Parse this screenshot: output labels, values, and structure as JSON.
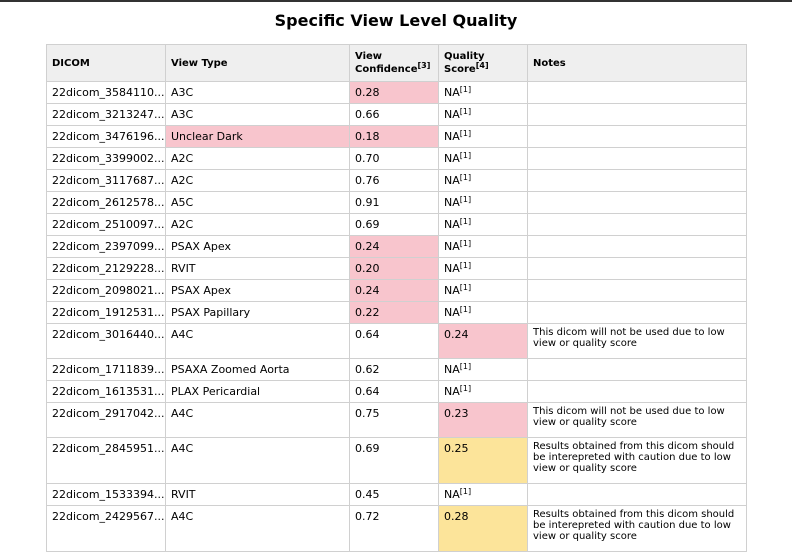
{
  "title": "Specific View Level Quality",
  "colors": {
    "low": "#f8c5cd",
    "caution": "#fce49a",
    "header_bg": "#efefef"
  },
  "columns": {
    "dicom": "DICOM",
    "view_type": "View Type",
    "confidence": "View",
    "confidence_line2": "Confidence",
    "confidence_ref": "[3]",
    "quality": "Quality",
    "quality_line2": "Score",
    "quality_ref": "[4]",
    "notes": "Notes"
  },
  "rows": [
    {
      "dicom": "22dicom_3584110...",
      "view": "A3C",
      "conf": "0.28",
      "score": "NA",
      "score_ref": "[1]",
      "notes": ""
    },
    {
      "dicom": "22dicom_3213247...",
      "view": "A3C",
      "conf": "0.66",
      "score": "NA",
      "score_ref": "[1]",
      "notes": ""
    },
    {
      "dicom": "22dicom_3476196...",
      "view": "Unclear Dark",
      "conf": "0.18",
      "score": "NA",
      "score_ref": "[1]",
      "notes": ""
    },
    {
      "dicom": "22dicom_3399002...",
      "view": "A2C",
      "conf": "0.70",
      "score": "NA",
      "score_ref": "[1]",
      "notes": ""
    },
    {
      "dicom": "22dicom_3117687...",
      "view": "A2C",
      "conf": "0.76",
      "score": "NA",
      "score_ref": "[1]",
      "notes": ""
    },
    {
      "dicom": "22dicom_2612578...",
      "view": "A5C",
      "conf": "0.91",
      "score": "NA",
      "score_ref": "[1]",
      "notes": ""
    },
    {
      "dicom": "22dicom_2510097...",
      "view": "A2C",
      "conf": "0.69",
      "score": "NA",
      "score_ref": "[1]",
      "notes": ""
    },
    {
      "dicom": "22dicom_2397099...",
      "view": "PSAX Apex",
      "conf": "0.24",
      "score": "NA",
      "score_ref": "[1]",
      "notes": ""
    },
    {
      "dicom": "22dicom_2129228...",
      "view": "RVIT",
      "conf": "0.20",
      "score": "NA",
      "score_ref": "[1]",
      "notes": ""
    },
    {
      "dicom": "22dicom_2098021...",
      "view": "PSAX Apex",
      "conf": "0.24",
      "score": "NA",
      "score_ref": "[1]",
      "notes": ""
    },
    {
      "dicom": "22dicom_1912531...",
      "view": "PSAX Papillary",
      "conf": "0.22",
      "score": "NA",
      "score_ref": "[1]",
      "notes": ""
    },
    {
      "dicom": "22dicom_3016440...",
      "view": "A4C",
      "conf": "0.64",
      "score": "0.24",
      "score_ref": "",
      "notes": "This dicom will not be used due to low view or quality score"
    },
    {
      "dicom": "22dicom_1711839...",
      "view": "PSAXA Zoomed Aorta",
      "conf": "0.62",
      "score": "NA",
      "score_ref": "[1]",
      "notes": ""
    },
    {
      "dicom": "22dicom_1613531...",
      "view": "PLAX Pericardial",
      "conf": "0.64",
      "score": "NA",
      "score_ref": "[1]",
      "notes": ""
    },
    {
      "dicom": "22dicom_2917042...",
      "view": "A4C",
      "conf": "0.75",
      "score": "0.23",
      "score_ref": "",
      "notes": "This dicom will not be used due to low view or quality score"
    },
    {
      "dicom": "22dicom_2845951...",
      "view": "A4C",
      "conf": "0.69",
      "score": "0.25",
      "score_ref": "",
      "notes": "Results obtained from this dicom should be interepreted with caution due to low view or quality score"
    },
    {
      "dicom": "22dicom_1533394...",
      "view": "RVIT",
      "conf": "0.45",
      "score": "NA",
      "score_ref": "[1]",
      "notes": ""
    },
    {
      "dicom": "22dicom_2429567...",
      "view": "A4C",
      "conf": "0.72",
      "score": "0.28",
      "score_ref": "",
      "notes": "Results obtained from this dicom should be interepreted with caution due to low view or quality score"
    }
  ]
}
